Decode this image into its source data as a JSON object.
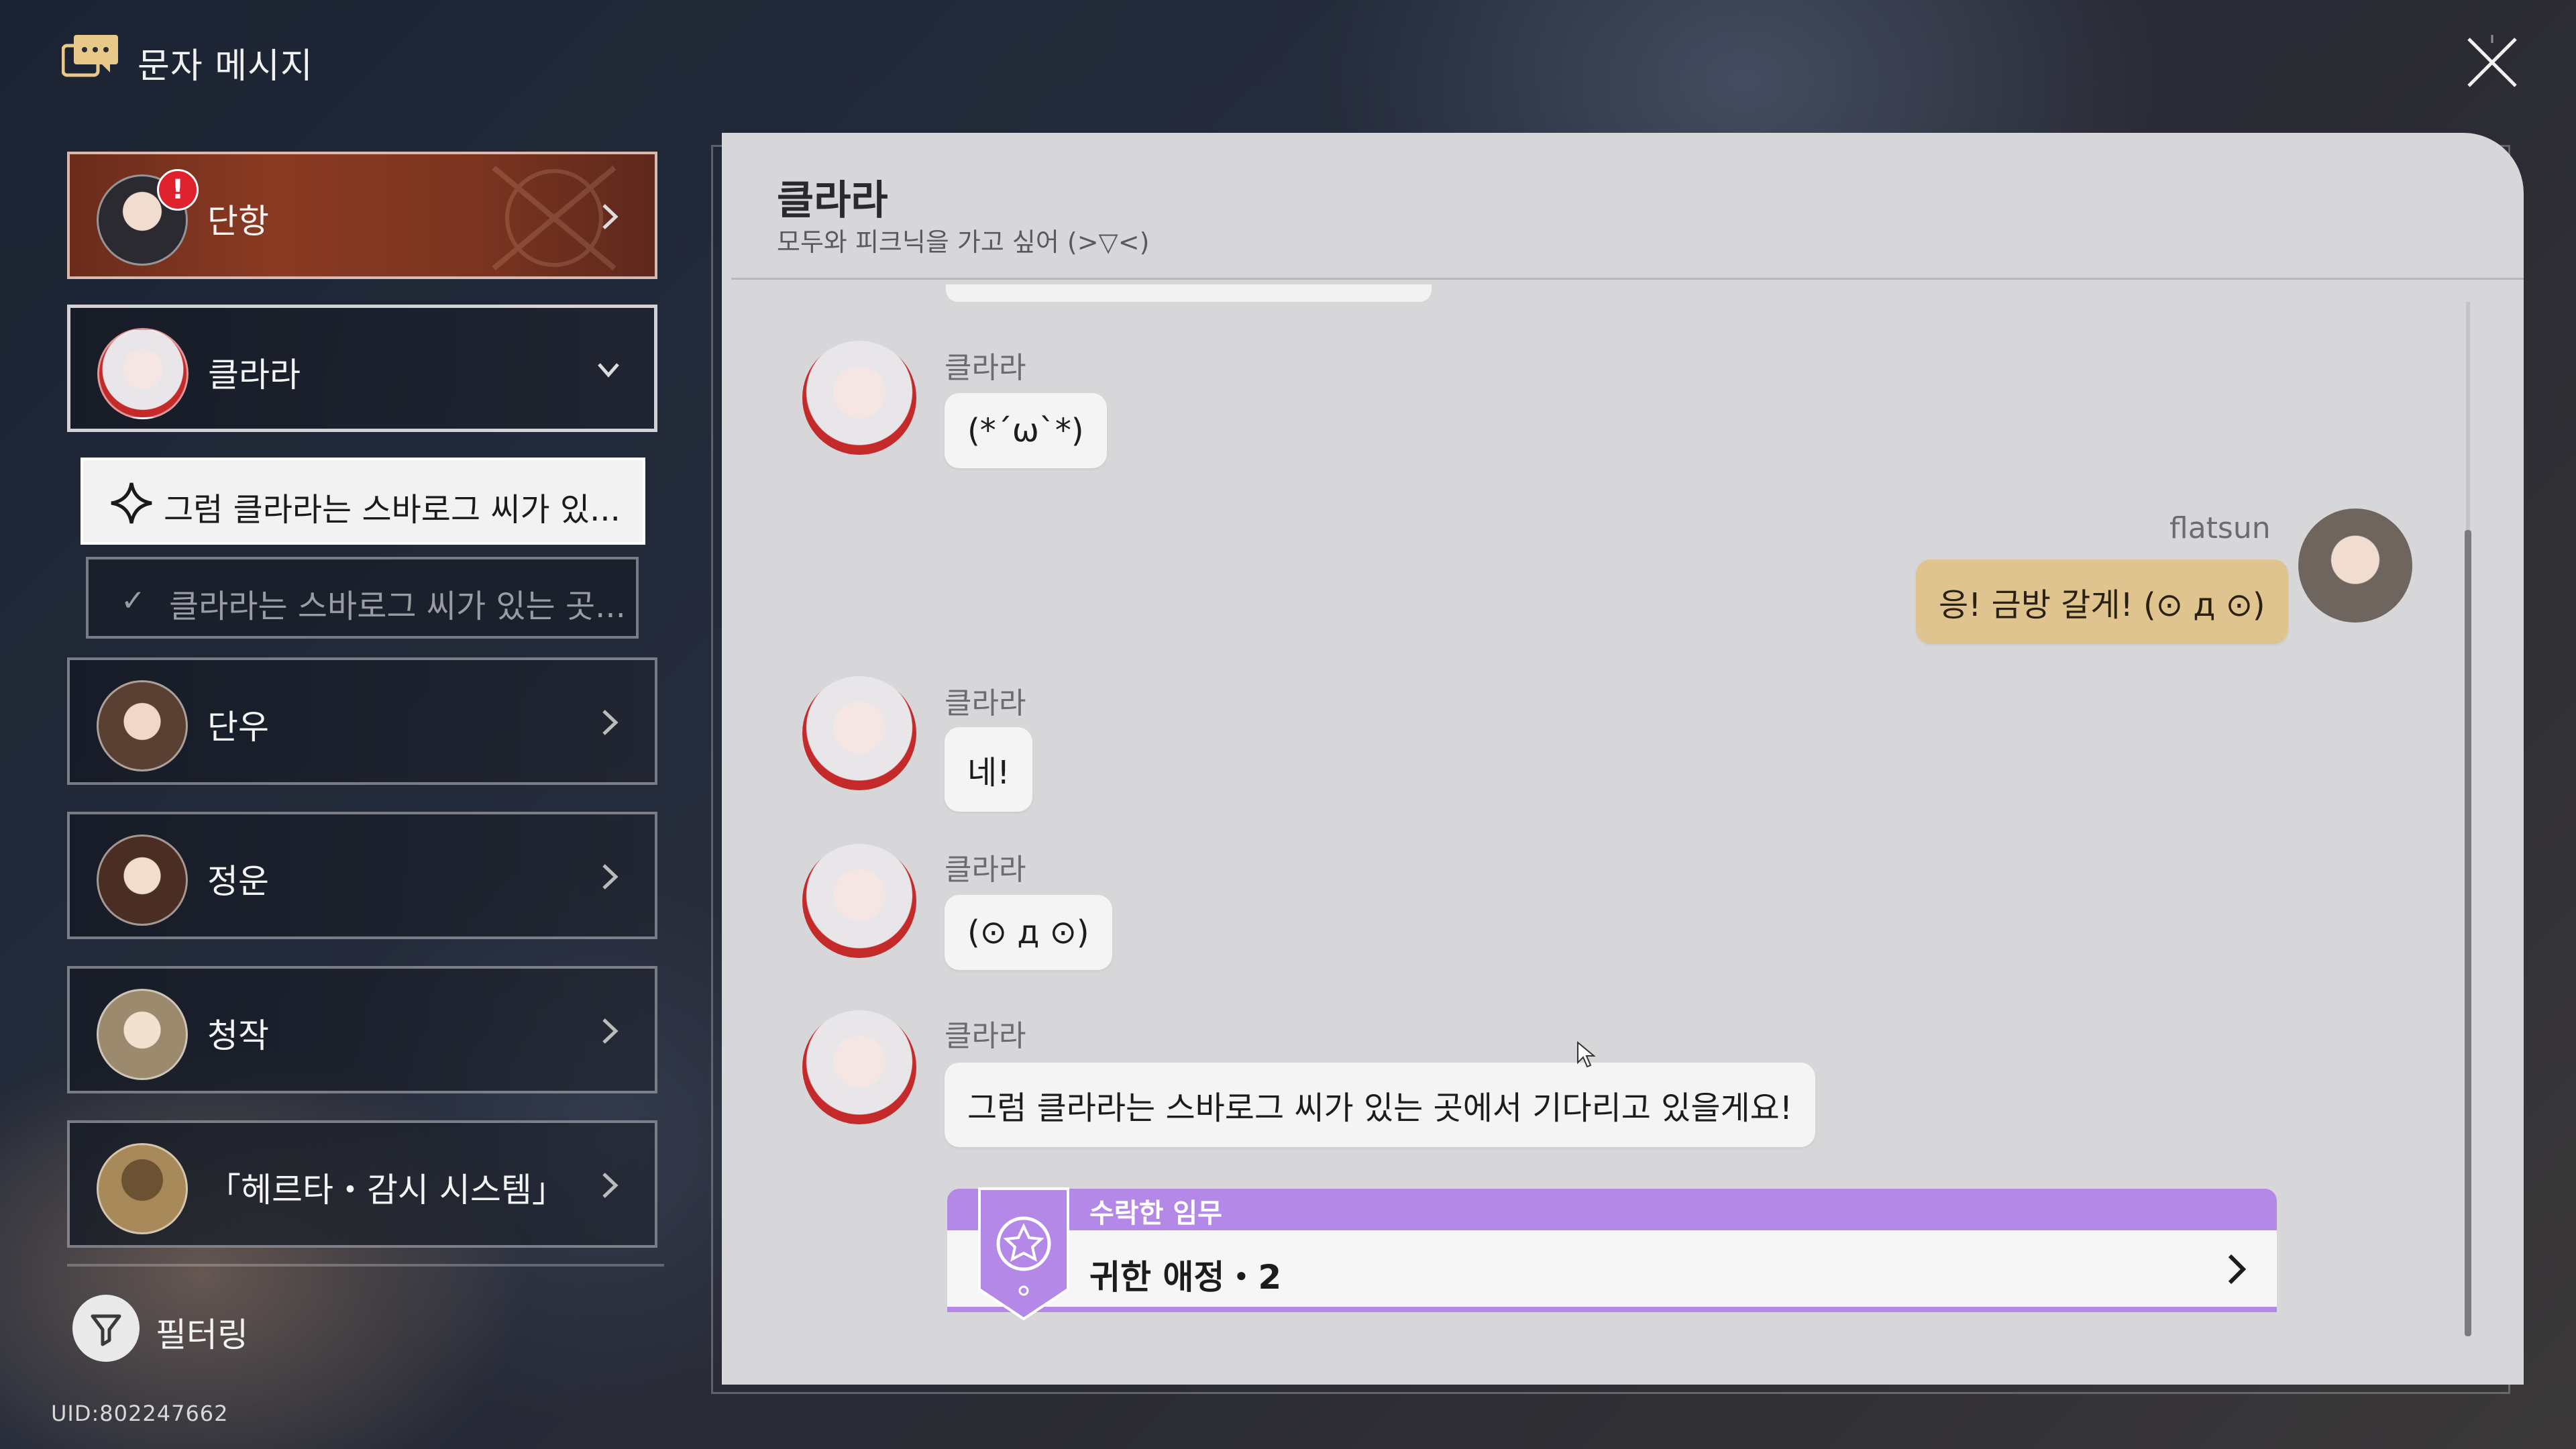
{
  "header": {
    "title": "문자 메시지",
    "icon": "message-bubble-icon",
    "close_icon": "close-icon"
  },
  "contacts": [
    {
      "name": "단항",
      "state": "active",
      "has_alert": true,
      "alert": "!"
    },
    {
      "name": "클라라",
      "state": "open"
    },
    {
      "name": "단우"
    },
    {
      "name": "정운"
    },
    {
      "name": "청작"
    },
    {
      "name": "「헤르타・감시 시스템」"
    }
  ],
  "threads": [
    {
      "label": "그럼 클라라는 스바로그 씨가 있...",
      "selected": true,
      "icon": "diamond-star-icon"
    },
    {
      "label": "클라라는 스바로그 씨가 있는 곳...",
      "completed": true,
      "icon": "check-icon"
    }
  ],
  "filter": {
    "label": "필터링",
    "icon": "filter-icon"
  },
  "uid": "UID:802247662",
  "chat": {
    "title": "클라라",
    "subtitle": "모두와 피크닉을 가고 싶어 (>▽<)",
    "messages": [
      {
        "sender": "클라라",
        "text": "(*´ω`*)",
        "mine": false
      },
      {
        "sender": "flatsun",
        "text": "응! 금방 갈게! (⊙ д ⊙)",
        "mine": true
      },
      {
        "sender": "클라라",
        "text": "네!",
        "mine": false
      },
      {
        "sender": "클라라",
        "text": "(⊙ д ⊙)",
        "mine": false
      },
      {
        "sender": "클라라",
        "text": "그럼 클라라는 스바로그 씨가 있는 곳에서 기다리고 있을게요!",
        "mine": false
      }
    ],
    "mission": {
      "header": "수락한 임무",
      "title": "귀한 애정・2"
    }
  },
  "colors": {
    "active_contact": "#8a3a22",
    "panel_bg": "#d7d7d9",
    "my_bubble": "#e0c48f",
    "other_bubble": "#f4f4f5",
    "mission_accent": "#b488e6",
    "alert": "#e0222e"
  }
}
